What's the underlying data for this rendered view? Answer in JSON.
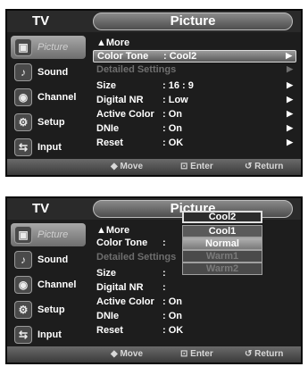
{
  "screen1": {
    "app_title": "TV",
    "menu_title": "Picture",
    "sidebar": [
      {
        "label": "Picture",
        "icon": "picture-icon",
        "glyph": "▣"
      },
      {
        "label": "Sound",
        "icon": "sound-icon",
        "glyph": "♪"
      },
      {
        "label": "Channel",
        "icon": "channel-icon",
        "glyph": "◉"
      },
      {
        "label": "Setup",
        "icon": "setup-icon",
        "glyph": "⚙"
      },
      {
        "label": "Input",
        "icon": "input-icon",
        "glyph": "⇆"
      }
    ],
    "more_label": "▲More",
    "rows": [
      {
        "key": "Color Tone",
        "value": ": Cool2",
        "arrow": "▶"
      },
      {
        "key": "Detailed Settings",
        "value": "",
        "arrow": "▶"
      },
      {
        "key": "Size",
        "value": ": 16 : 9",
        "arrow": "▶"
      },
      {
        "key": "Digital NR",
        "value": ": Low",
        "arrow": "▶"
      },
      {
        "key": "Active Color",
        "value": ": On",
        "arrow": "▶"
      },
      {
        "key": "DNIe",
        "value": ": On",
        "arrow": "▶"
      },
      {
        "key": "Reset",
        "value": ": OK",
        "arrow": "▶"
      }
    ],
    "bottom": {
      "move": "◆ Move",
      "enter": "⊡ Enter",
      "return": "↺ Return"
    }
  },
  "screen2": {
    "app_title": "TV",
    "menu_title": "Picture",
    "sidebar": [
      {
        "label": "Picture",
        "icon": "picture-icon",
        "glyph": "▣"
      },
      {
        "label": "Sound",
        "icon": "sound-icon",
        "glyph": "♪"
      },
      {
        "label": "Channel",
        "icon": "channel-icon",
        "glyph": "◉"
      },
      {
        "label": "Setup",
        "icon": "setup-icon",
        "glyph": "⚙"
      },
      {
        "label": "Input",
        "icon": "input-icon",
        "glyph": "⇆"
      }
    ],
    "more_label": "▲More",
    "rows": [
      {
        "key": "Color Tone",
        "value": ":"
      },
      {
        "key": "Detailed Settings",
        "value": ""
      },
      {
        "key": "Size",
        "value": ":"
      },
      {
        "key": "Digital NR",
        "value": ":"
      },
      {
        "key": "Active Color",
        "value": ": On"
      },
      {
        "key": "DNIe",
        "value": ": On"
      },
      {
        "key": "Reset",
        "value": ": OK"
      }
    ],
    "dropdown": {
      "current": "Cool2",
      "options": [
        "Cool1",
        "Normal",
        "Warm1",
        "Warm2"
      ]
    },
    "bottom": {
      "move": "◆ Move",
      "enter": "⊡ Enter",
      "return": "↺ Return"
    }
  }
}
